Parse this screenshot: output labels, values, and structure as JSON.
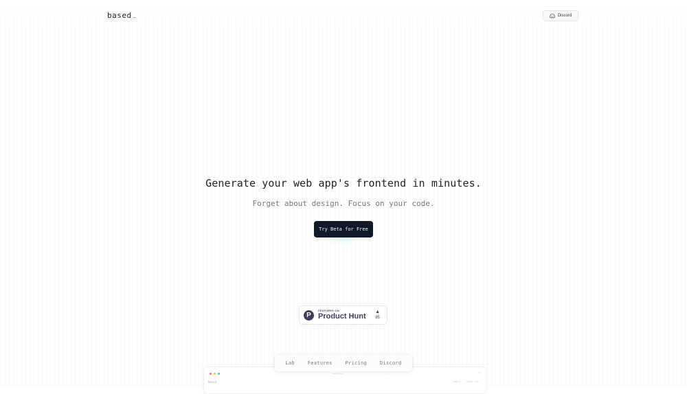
{
  "header": {
    "logo": "based",
    "discord_button": "Discord"
  },
  "hero": {
    "title": "Generate your web app's frontend in minutes.",
    "subtitle": "Forget about design. Focus on your code.",
    "cta": "Try Beta for Free"
  },
  "product_hunt": {
    "small_label": "FEATURED ON",
    "name": "Product Hunt",
    "votes": "95",
    "logo_letter": "P",
    "upvote_icon": "triangle-up-icon"
  },
  "floating_nav": {
    "items": [
      {
        "label": "Lab"
      },
      {
        "label": "Features"
      },
      {
        "label": "Pricing"
      },
      {
        "label": "Discord"
      }
    ]
  },
  "mockup": {
    "brand": "Based",
    "url": "based.dev",
    "actions": [
      "Import",
      "Share link"
    ]
  },
  "colors": {
    "cta_bg": "#111827",
    "accent": "#5eead4",
    "product_hunt": "#3d3f5c",
    "traffic_lights": [
      "#f87171",
      "#fbbf24",
      "#34d399"
    ]
  }
}
